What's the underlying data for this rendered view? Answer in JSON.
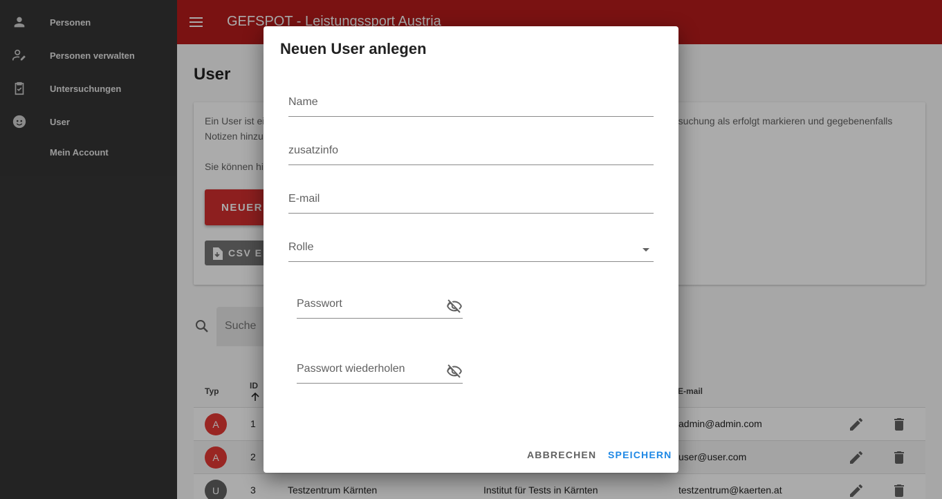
{
  "app": {
    "title": "GEFSPOT - Leistungssport Austria"
  },
  "sidebar": {
    "items": [
      {
        "label": "Personen",
        "icon": "person-icon"
      },
      {
        "label": "Personen verwalten",
        "icon": "person-edit-icon"
      },
      {
        "label": "Untersuchungen",
        "icon": "clipboard-check-icon"
      },
      {
        "label": "User",
        "icon": "face-icon"
      },
      {
        "label": "Mein Account",
        "icon": ""
      }
    ]
  },
  "page": {
    "title": "User",
    "desc_line1_left": "Ein User ist ei",
    "desc_line1_right": "rsuchung als erfolgt markieren und gegebenenfalls",
    "desc_line2": "Notizen hinzu",
    "desc_line3": "Sie können hi",
    "btn_new": "NEUER",
    "btn_csv": "CSV E",
    "search_placeholder": "Suche"
  },
  "table": {
    "headers": {
      "typ": "Typ",
      "id": "ID",
      "email": "E-mail"
    },
    "rows": [
      {
        "avatar": "A",
        "id": "1",
        "name": "",
        "institut": "",
        "email": "admin@admin.com"
      },
      {
        "avatar": "A",
        "id": "2",
        "name": "",
        "institut": "",
        "email": "user@user.com"
      },
      {
        "avatar": "U",
        "id": "3",
        "name": "Testzentrum Kärnten",
        "institut": "Institut für Tests in Kärnten",
        "email": "testzentrum@kaerten.at"
      }
    ]
  },
  "dialog": {
    "title": "Neuen User anlegen",
    "fields": {
      "name": "Name",
      "zusatzinfo": "zusatzinfo",
      "email": "E-mail",
      "rolle": "Rolle",
      "passwort": "Passwort",
      "passwort_wiederholen": "Passwort wiederholen"
    },
    "cancel": "ABBRECHEN",
    "save": "SPEICHERN"
  },
  "colors": {
    "appbar": "#b71c1c",
    "sidebar": "#353535",
    "primary_button": "#d32f2f",
    "save_link": "#1e88e5",
    "avatar_admin": "#e53935",
    "avatar_user": "#616161"
  }
}
